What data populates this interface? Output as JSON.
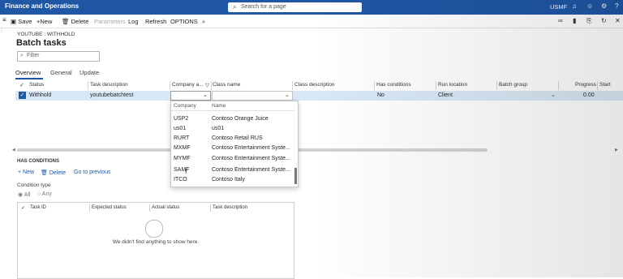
{
  "app": {
    "title": "Finance and Operations",
    "search_placeholder": "Search for a page",
    "company": "USMF",
    "icons": [
      "bell-icon",
      "smiley-icon",
      "gear-icon",
      "help-icon"
    ]
  },
  "actions": {
    "save": "Save",
    "new": "New",
    "delete": "Delete",
    "parameters": "Parameters",
    "log": "Log",
    "refresh": "Refresh",
    "options": "OPTIONS"
  },
  "page": {
    "breadcrumb": "YOUTUBE : WITHHOLD",
    "title": "Batch tasks",
    "filter_placeholder": "Filter"
  },
  "tabs": [
    "Overview",
    "General",
    "Update"
  ],
  "grid": {
    "columns": [
      "Status",
      "Task description",
      "Company a...",
      "Class name",
      "Class description",
      "Has conditions",
      "Run location",
      "Batch group",
      "Progress",
      "Start"
    ],
    "row": {
      "status": "Withhold",
      "task_description": "youtubebatchtest",
      "company": "",
      "class_name": "",
      "class_description": "",
      "has_conditions": "No",
      "run_location": "Client",
      "batch_group": "",
      "progress": "0.00"
    }
  },
  "dropdown": {
    "headers": [
      "Company",
      "Name"
    ],
    "items": [
      {
        "code": "USP2",
        "name": "Contoso Orange Juice"
      },
      {
        "code": "us01",
        "name": "us01"
      },
      {
        "code": "RURT",
        "name": "Contoso Retail RUS"
      },
      {
        "code": "MXMF",
        "name": "Contoso Entertainment Syste..."
      },
      {
        "code": "MYMF",
        "name": "Contoso Entertainment Syste..."
      },
      {
        "code": "SAMF",
        "name": "Contoso Entertainment Syste..."
      },
      {
        "code": "ITCO",
        "name": "Contoso Italy"
      }
    ]
  },
  "conditions": {
    "title": "HAS CONDITIONS",
    "new": "New",
    "delete": "Delete",
    "go_previous": "Go to previous",
    "type_label": "Condition type",
    "all": "All",
    "any": "Any",
    "columns": [
      "Task ID",
      "Expected status",
      "Actual status",
      "Task description"
    ],
    "empty": "We didn't find anything to show here."
  }
}
